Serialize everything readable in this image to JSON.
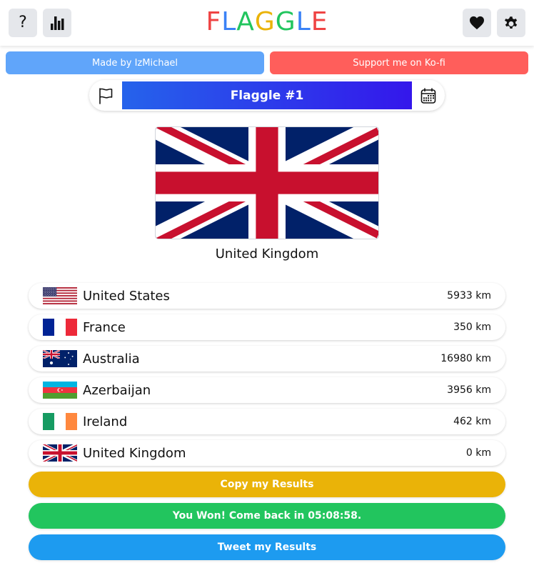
{
  "header": {
    "logo_letters": [
      {
        "char": "F",
        "color": "#ef4444"
      },
      {
        "char": "L",
        "color": "#3b82f6"
      },
      {
        "char": "A",
        "color": "#22c55e"
      },
      {
        "char": "G",
        "color": "#eab308"
      },
      {
        "char": "G",
        "color": "#22c55e"
      },
      {
        "char": "L",
        "color": "#3b82f6"
      },
      {
        "char": "E",
        "color": "#ef4444"
      }
    ],
    "help_glyph": "?",
    "icons": {
      "help": "question-mark-icon",
      "stats": "bar-chart-icon",
      "support": "heart-icon",
      "settings": "gear-icon"
    }
  },
  "links": {
    "made_by_label": "Made by IzMichael",
    "made_by_color": "#60a5fa",
    "kofi_label": "Support me on Ko-fi",
    "kofi_color": "#ff5e5b"
  },
  "game": {
    "title": "Flaggle #1",
    "title_gradient": [
      "#2563eb",
      "#3417eb"
    ],
    "left_icon": "flag-icon",
    "right_icon": "calendar-icon"
  },
  "target": {
    "country": "United Kingdom",
    "flag": "gb"
  },
  "guesses": [
    {
      "country": "United States",
      "distance": "5933 km",
      "flag": "us"
    },
    {
      "country": "France",
      "distance": "350 km",
      "flag": "fr"
    },
    {
      "country": "Australia",
      "distance": "16980 km",
      "flag": "au"
    },
    {
      "country": "Azerbaijan",
      "distance": "3956 km",
      "flag": "az"
    },
    {
      "country": "Ireland",
      "distance": "462 km",
      "flag": "ie"
    },
    {
      "country": "United Kingdom",
      "distance": "0 km",
      "flag": "gb"
    }
  ],
  "actions": {
    "copy_label": "Copy my Results",
    "copy_color": "#eab308",
    "won_label": "You Won! Come back in 05:08:58.",
    "won_color": "#22c55e",
    "tweet_label": "Tweet my Results",
    "tweet_color": "#1d9bf0"
  }
}
